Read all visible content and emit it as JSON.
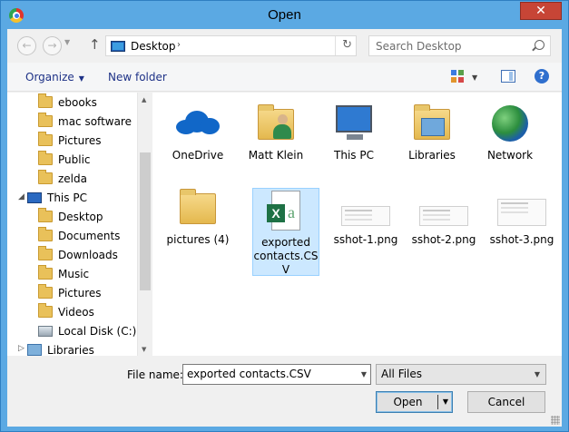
{
  "window": {
    "title": "Open",
    "close_label": "✕"
  },
  "address": {
    "location": "Desktop",
    "search_placeholder": "Search Desktop"
  },
  "commands": {
    "organize": "Organize",
    "new_folder": "New folder",
    "help": "?"
  },
  "nav": {
    "items": [
      {
        "label": "ebooks",
        "icon": "folder-icon"
      },
      {
        "label": "mac software",
        "icon": "folder-icon"
      },
      {
        "label": "Pictures",
        "icon": "folder-icon"
      },
      {
        "label": "Public",
        "icon": "folder-icon"
      },
      {
        "label": "zelda",
        "icon": "folder-icon"
      },
      {
        "label": "This PC",
        "icon": "computer-icon"
      },
      {
        "label": "Desktop",
        "icon": "desktop-folder-icon"
      },
      {
        "label": "Documents",
        "icon": "documents-folder-icon"
      },
      {
        "label": "Downloads",
        "icon": "downloads-folder-icon"
      },
      {
        "label": "Music",
        "icon": "music-folder-icon"
      },
      {
        "label": "Pictures",
        "icon": "pictures-folder-icon"
      },
      {
        "label": "Videos",
        "icon": "videos-folder-icon"
      },
      {
        "label": "Local Disk (C:)",
        "icon": "disk-icon"
      },
      {
        "label": "Libraries",
        "icon": "libraries-icon"
      }
    ]
  },
  "files": [
    {
      "label": "OneDrive",
      "icon": "onedrive-icon"
    },
    {
      "label": "Matt Klein",
      "icon": "user-folder-icon"
    },
    {
      "label": "This PC",
      "icon": "computer-icon"
    },
    {
      "label": "Libraries",
      "icon": "libraries-icon"
    },
    {
      "label": "Network",
      "icon": "network-icon"
    },
    {
      "label": "pictures (4)",
      "icon": "folder-icon"
    },
    {
      "label": "exported contacts.CSV",
      "icon": "excel-csv-icon",
      "selected": true
    },
    {
      "label": "sshot-1.png",
      "icon": "image-thumbnail-icon"
    },
    {
      "label": "sshot-2.png",
      "icon": "image-thumbnail-icon"
    },
    {
      "label": "sshot-3.png",
      "icon": "image-thumbnail-icon"
    }
  ],
  "footer": {
    "file_name_label": "File name:",
    "file_name_value": "exported contacts.CSV",
    "file_type": "All Files",
    "open_label": "Open",
    "cancel_label": "Cancel"
  },
  "colors": {
    "accent": "#5ba9e3",
    "close": "#c74536",
    "selection": "#cce8ff",
    "link": "#1e3287"
  }
}
